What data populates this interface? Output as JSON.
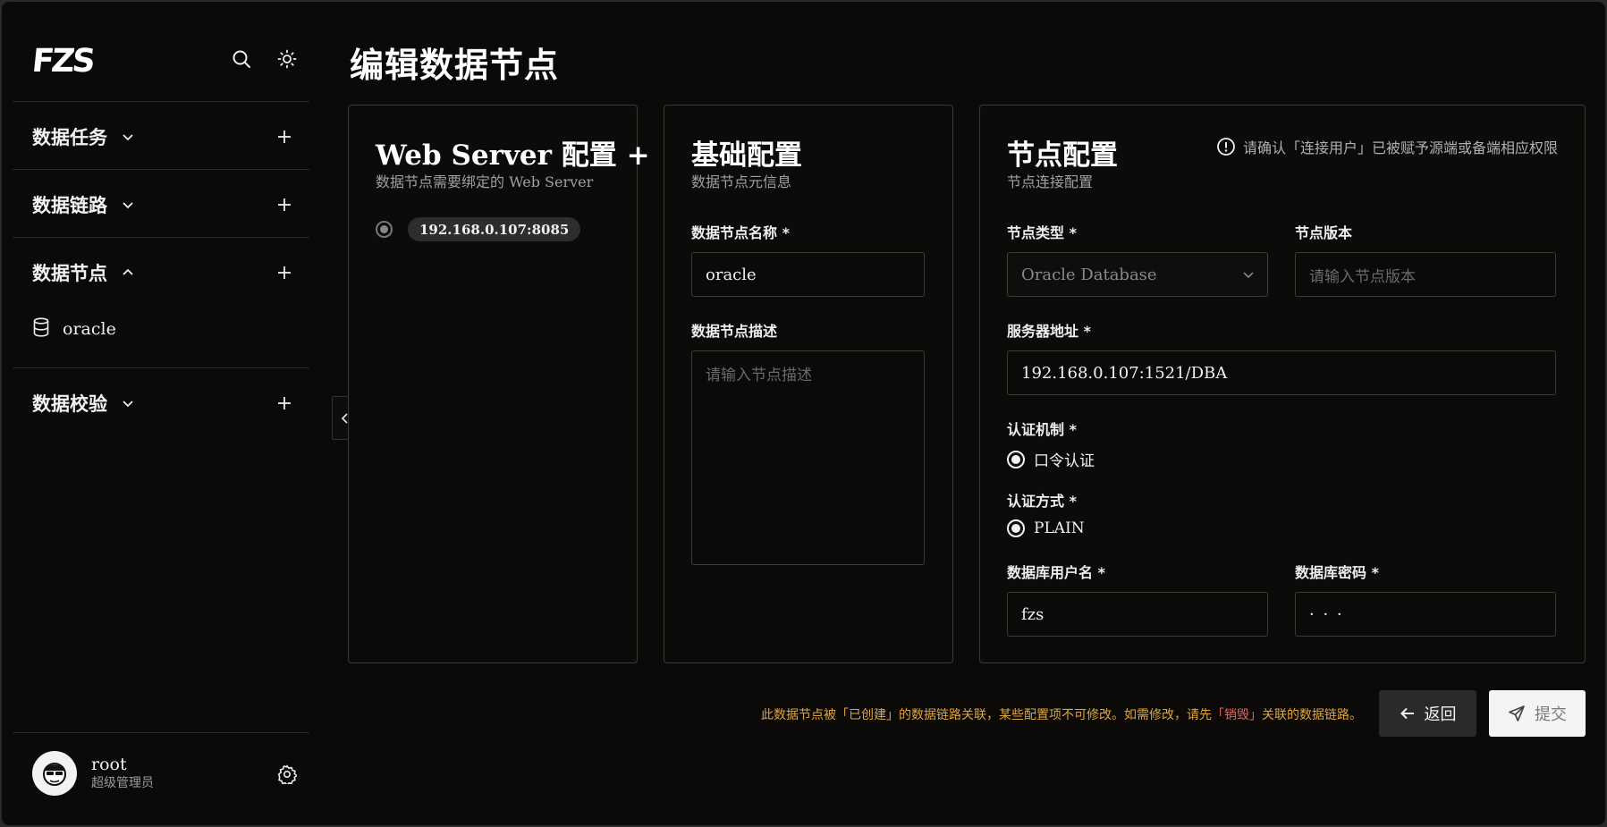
{
  "app": {
    "logo": "FZS"
  },
  "page": {
    "title": "编辑数据节点"
  },
  "sidebar": {
    "nav": [
      {
        "label": "数据任务",
        "expanded": false
      },
      {
        "label": "数据链路",
        "expanded": false
      },
      {
        "label": "数据节点",
        "expanded": true,
        "children": [
          "oracle"
        ]
      },
      {
        "label": "数据校验",
        "expanded": false
      }
    ],
    "user": {
      "name": "root",
      "role": "超级管理员"
    }
  },
  "webserver": {
    "title": "Web Server 配置 +",
    "subtitle": "数据节点需要绑定的 Web Server",
    "option": "192.168.0.107:8085"
  },
  "basic": {
    "title": "基础配置",
    "subtitle": "数据节点元信息",
    "name_label": "数据节点名称 *",
    "name_value": "oracle",
    "desc_label": "数据节点描述",
    "desc_placeholder": "请输入节点描述"
  },
  "node": {
    "title": "节点配置",
    "subtitle": "节点连接配置",
    "notice": "请确认「连接用户」已被赋予源端或备端相应权限",
    "type_label": "节点类型 *",
    "type_value": "Oracle Database",
    "version_label": "节点版本",
    "version_placeholder": "请输入节点版本",
    "addr_label": "服务器地址 *",
    "addr_value": "192.168.0.107:1521/DBA",
    "auth_label": "认证机制 *",
    "auth_value": "口令认证",
    "method_label": "认证方式 *",
    "method_value": "PLAIN",
    "user_label": "数据库用户名 *",
    "user_value": "fzs",
    "pwd_label": "数据库密码 *",
    "pwd_value": "· · ·"
  },
  "footer": {
    "warn_a": "此数据节点被「已创建」的数据链路关联，某些配置项不可修改。如需修改，请先",
    "warn_b": "「销毁」",
    "warn_c": "关联的数据链路。",
    "back": "返回",
    "submit": "提交"
  },
  "colors": {
    "background": "#0b0a09",
    "warning": "#e1a53a",
    "danger": "#e06a5a",
    "accent": "#f4f4f2"
  }
}
